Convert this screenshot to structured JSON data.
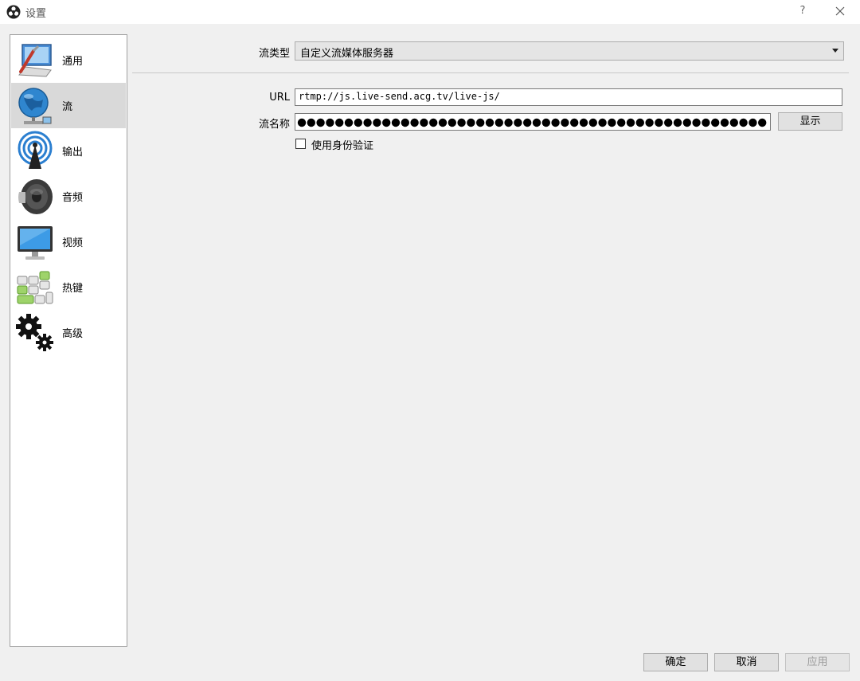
{
  "window": {
    "title": "设置",
    "help_label": "?"
  },
  "sidebar": {
    "items": [
      {
        "label": "通用",
        "icon": "general-icon",
        "selected": false
      },
      {
        "label": "流",
        "icon": "stream-globe-icon",
        "selected": true
      },
      {
        "label": "输出",
        "icon": "output-broadcast-icon",
        "selected": false
      },
      {
        "label": "音频",
        "icon": "audio-speaker-icon",
        "selected": false
      },
      {
        "label": "视频",
        "icon": "video-monitor-icon",
        "selected": false
      },
      {
        "label": "热键",
        "icon": "hotkeys-icon",
        "selected": false
      },
      {
        "label": "高级",
        "icon": "advanced-gears-icon",
        "selected": false
      }
    ]
  },
  "stream": {
    "type_label": "流类型",
    "type_value": "自定义流媒体服务器",
    "url_label": "URL",
    "url_value": "rtmp://js.live-send.acg.tv/live-js/",
    "key_label": "流名称",
    "key_masked": "●●●●●●●●●●●●●●●●●●●●●●●●●●●●●●●●●●●●●●●●●●●●●●●●●●",
    "show_label": "显示",
    "auth_label": "使用身份验证",
    "auth_checked": false
  },
  "footer": {
    "ok_label": "确定",
    "cancel_label": "取消",
    "apply_label": "应用"
  },
  "colors": {
    "selected_bg": "#d9d9d9",
    "accent_blue": "#1e7bc8",
    "accent_green": "#7dc242"
  }
}
